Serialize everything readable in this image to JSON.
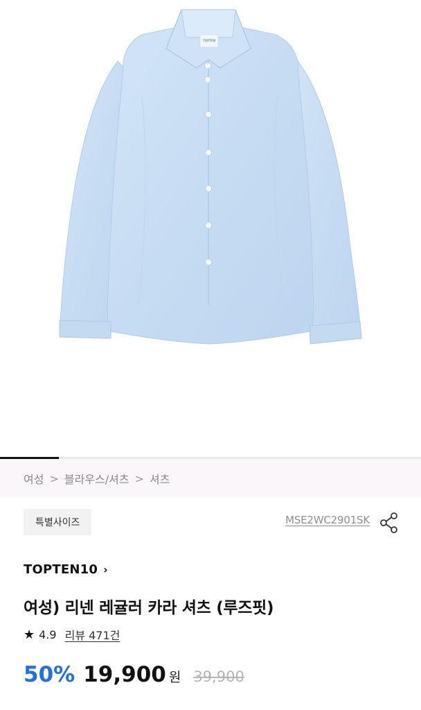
{
  "gallery": {
    "image_alt": "light blue women's linen shirt",
    "label_tag_text": "TOPTEN",
    "progress": 0.14
  },
  "breadcrumb": {
    "items": [
      "여성",
      "블라우스/셔츠",
      "셔츠"
    ],
    "separator": ">"
  },
  "product": {
    "badge": "특별사이즈",
    "code": "MSE2WC2901SK",
    "brand": "TOPTEN10",
    "brand_chevron": "›",
    "title": "여성) 리넨 레귤러 카라 셔츠 (루즈핏)",
    "rating": "4.9",
    "review_text": "리뷰 471건",
    "discount_rate": "50%",
    "sale_price": "19,900",
    "currency": "원",
    "original_price": "39,900"
  },
  "colors": {
    "shirt": "#c9def4",
    "discount": "#1f6fe6",
    "breadcrumb_bg": "#fbf6fa"
  },
  "icons": {
    "star": "★",
    "share": "share-icon"
  }
}
